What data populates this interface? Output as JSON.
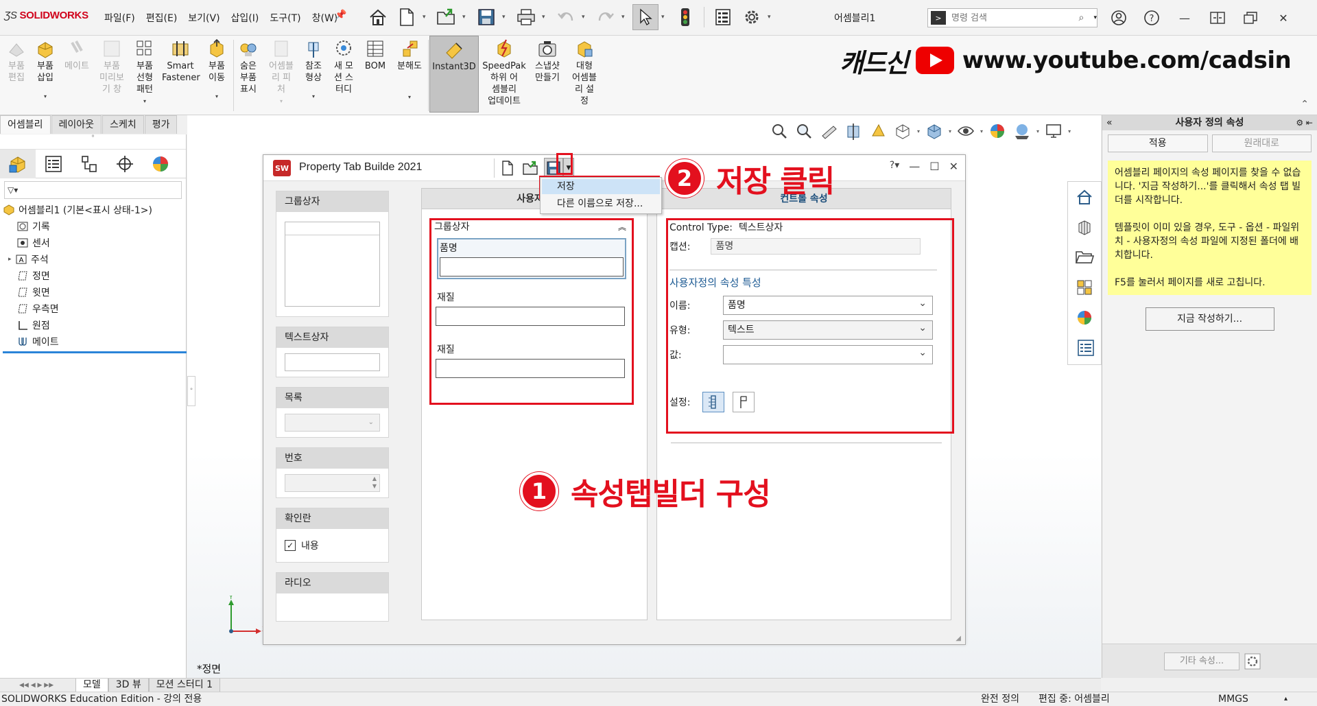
{
  "app": {
    "logo": "SOLIDWORKS",
    "menus": [
      "파일(F)",
      "편집(E)",
      "보기(V)",
      "삽입(I)",
      "도구(T)",
      "창(W)"
    ],
    "doc_title": "어셈블리1",
    "search_placeholder": "명령 검색"
  },
  "ribbon": {
    "buttons": [
      {
        "label": "부품\n편집",
        "disabled": true
      },
      {
        "label": "부품\n삽입",
        "disabled": false
      },
      {
        "label": "메이트",
        "disabled": true
      },
      {
        "label": "부품\n미리보\n기 창",
        "disabled": true
      },
      {
        "label": "부품\n선형\n패턴",
        "disabled": false
      },
      {
        "label": "Smart\nFastener",
        "disabled": false
      },
      {
        "label": "부품\n이동",
        "disabled": false
      },
      {
        "label": "숨은\n부품\n표시",
        "disabled": false
      },
      {
        "label": "어셈블\n리 피\n처",
        "disabled": true
      },
      {
        "label": "참조\n형상",
        "disabled": false
      },
      {
        "label": "새 모\n션 스\n터디",
        "disabled": false
      },
      {
        "label": "BOM",
        "disabled": false
      },
      {
        "label": "분해도",
        "disabled": false
      },
      {
        "label": "Instant3D",
        "disabled": false
      },
      {
        "label": "SpeedPak\n하위 어\n셈블리\n업데이트",
        "disabled": false
      },
      {
        "label": "스냅샷\n만들기",
        "disabled": false
      },
      {
        "label": "대형\n어셈블\n리 설\n정",
        "disabled": false
      }
    ],
    "brand_kr": "캐드신",
    "brand_url": "www.youtube.com/cadsin"
  },
  "tabs": [
    "어셈블리",
    "레이아웃",
    "스케치",
    "평가"
  ],
  "tree": {
    "root": "어셈블리1  (기본<표시 상태-1>)",
    "items": [
      "기록",
      "센서",
      "주석",
      "정면",
      "윗면",
      "우측면",
      "원점",
      "메이트"
    ]
  },
  "viewport": {
    "view_name": "*정면",
    "triad_x": "X",
    "triad_y": "Y"
  },
  "ptb": {
    "title": "Property Tab Builde   2021",
    "menu": {
      "save": "저장",
      "save_as": "다른 이름으로 저장..."
    },
    "palette": {
      "groupbox": "그룹상자",
      "textbox": "텍스트상자",
      "list": "목록",
      "number": "번호",
      "checkbox": "확인란",
      "checkbox_item": "내용",
      "radio": "라디오"
    },
    "center": {
      "header": "사용자정",
      "group_label": "그룹상자",
      "fields": [
        "품명",
        "재질",
        "재질"
      ]
    },
    "right": {
      "header": "컨트롤 속성",
      "control_type_label": "Control Type:",
      "control_type_value": "텍스트상자",
      "caption_label": "캡션:",
      "caption_value": "품명",
      "section": "사용자정의 속성 특성",
      "name_label": "이름:",
      "name_value": "품명",
      "type_label": "유형:",
      "type_value": "텍스트",
      "value_label": "값:",
      "value_value": "",
      "settings_label": "설정:"
    }
  },
  "annotations": {
    "step1_num": "1",
    "step1_text": "속성탭빌더 구성",
    "step2_num": "2",
    "step2_text": "저장 클릭",
    "color": "#e3101e"
  },
  "right_panel": {
    "title": "사용자 정의 속성",
    "apply": "적용",
    "revert": "원래대로",
    "note_p1": "어셈블리 페이지의 속성 페이지를 찾을 수 없습니다. '지금 작성하기...'를 클릭해서 속성 탭 빌더를 시작합니다.",
    "note_p2": "템플릿이 이미 있을 경우, 도구 - 옵션 - 파일위치 - 사용자정의 속성 파일에 지정된 폴더에 배치합니다.",
    "note_p3": "F5를 눌러서 페이지를 새로 고칩니다.",
    "create_now": "지금 작성하기...",
    "more_props": "기타 속성..."
  },
  "bottom_tabs": [
    "모델",
    "3D 뷰",
    "모션 스터디 1"
  ],
  "status": {
    "edition": "SOLIDWORKS Education Edition - 강의 전용",
    "defined": "완전 정의",
    "editing": "편집 중: 어셈블리",
    "units": "MMGS"
  }
}
